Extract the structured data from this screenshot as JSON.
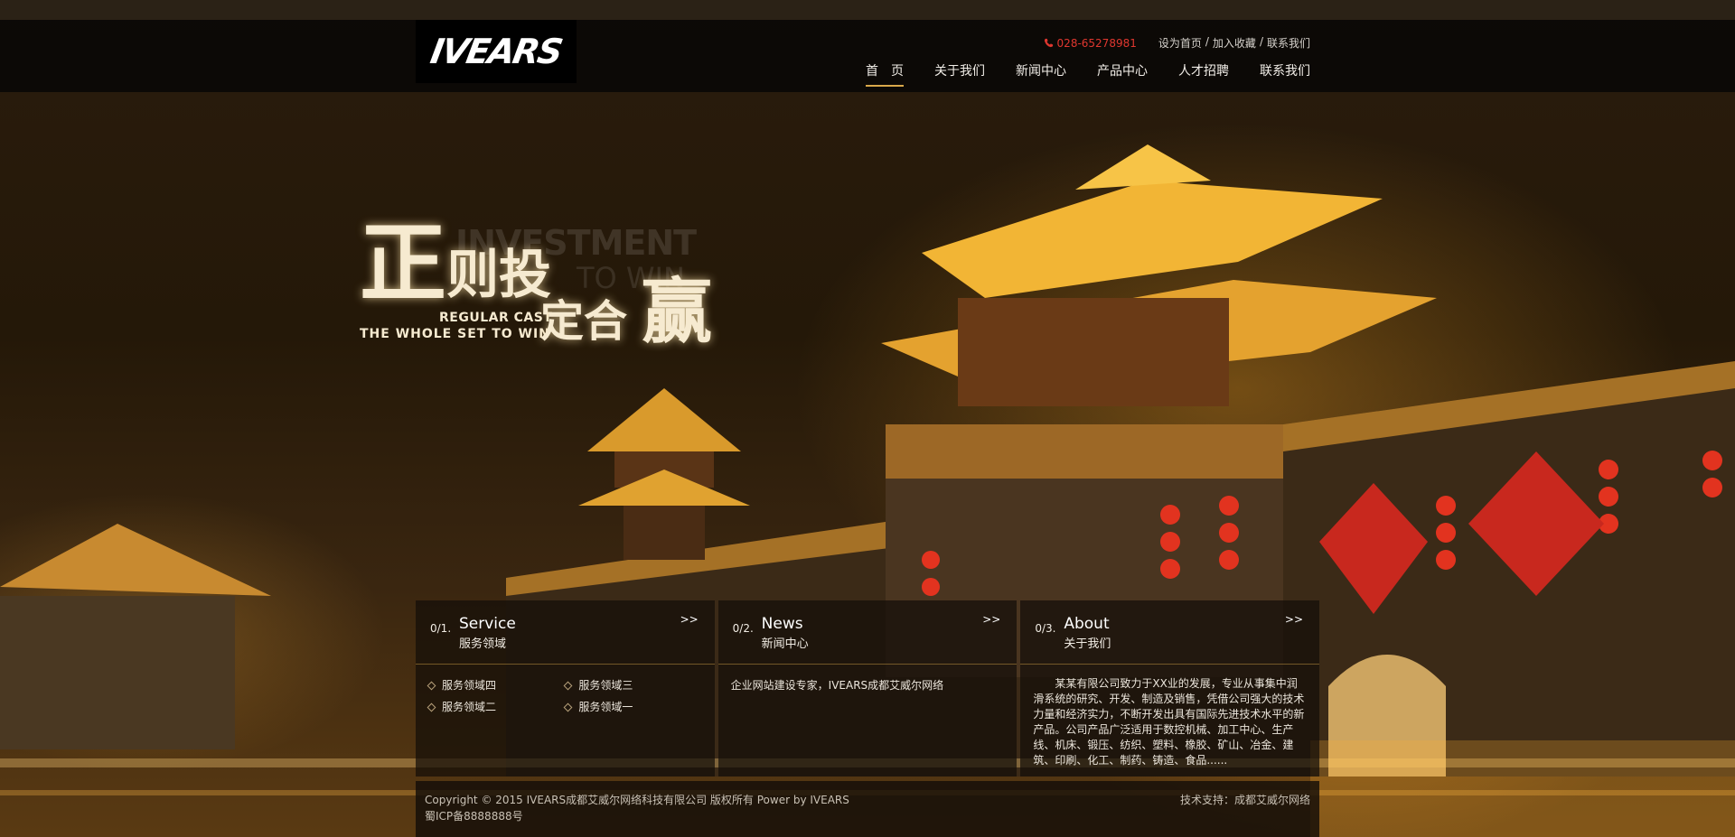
{
  "header": {
    "logo_text": "IVEARS",
    "phone": "028-65278981",
    "top_links": [
      "设为首页",
      "/",
      "加入收藏",
      "/",
      "联系我们"
    ],
    "nav": [
      "首　页",
      "关于我们",
      "新闻中心",
      "产品中心",
      "人才招聘",
      "联系我们"
    ],
    "active_nav": 0
  },
  "banner": {
    "slogan_line1_big": "正",
    "slogan_line1": "则投",
    "slogan_ghost_en": "INVESTMENT",
    "slogan_ghost_en2": "TO WIN",
    "slogan_en1": "REGULAR CAST",
    "slogan_en2": "THE WHOLE SET TO WIN",
    "slogan_line2": "定合",
    "slogan_line2_big": "赢"
  },
  "panels": [
    {
      "num": "0/1.",
      "title": "Service",
      "subtitle": "服务领域",
      "more": ">>",
      "items": [
        "服务领域四",
        "服务领域三",
        "服务领域二",
        "服务领域一"
      ]
    },
    {
      "num": "0/2.",
      "title": "News",
      "subtitle": "新闻中心",
      "more": ">>",
      "text": "企业网站建设专家，IVEARS成都艾威尔网络"
    },
    {
      "num": "0/3.",
      "title": "About",
      "subtitle": "关于我们",
      "more": ">>",
      "text": "某某有限公司致力于XX业的发展，专业从事集中润滑系统的研究、开发、制造及销售，凭借公司强大的技术力量和经济实力，不断开发出具有国际先进技术水平的新产品。公司产品广泛适用于数控机械、加工中心、生产线、机床、锻压、纺织、塑料、橡胶、矿山、冶金、建筑、印刷、化工、制药、铸造、食品......"
    }
  ],
  "footer": {
    "copyright": "Copyright © 2015 IVEARS成都艾威尔网络科技有限公司 版权所有 Power by IVEARS",
    "icp": "蜀ICP备8888888号",
    "tech": "技术支持：成都艾威尔网络"
  },
  "colors": {
    "accent": "#d9a84a",
    "phone": "#e0372f"
  }
}
